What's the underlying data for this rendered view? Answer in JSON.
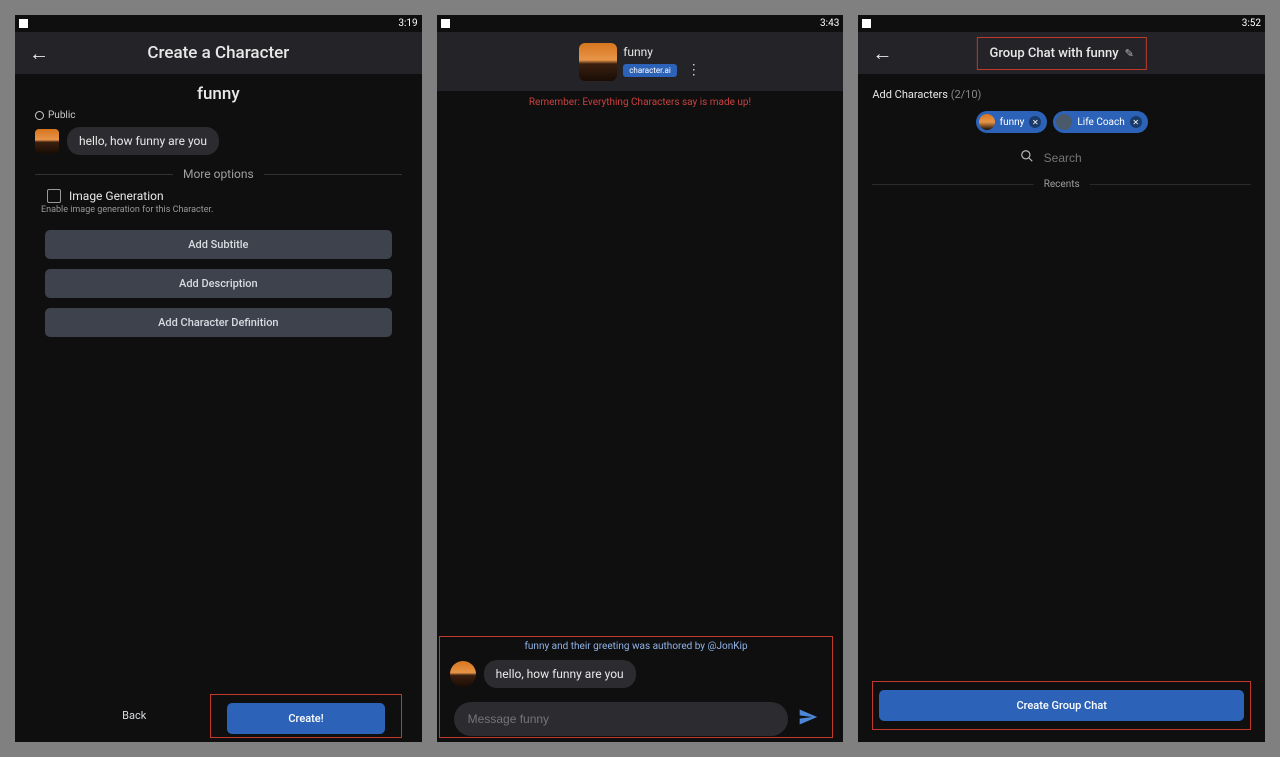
{
  "screen1": {
    "status_time": "3:19",
    "header_title": "Create a Character",
    "character_name": "funny",
    "visibility_label": "Public",
    "greeting": "hello, how funny are you",
    "more_options_label": "More options",
    "image_gen_label": "Image Generation",
    "image_gen_help": "Enable image generation for this Character.",
    "buttons": {
      "add_subtitle": "Add Subtitle",
      "add_description": "Add Description",
      "add_definition": "Add Character Definition"
    },
    "footer_back": "Back",
    "footer_create": "Create!"
  },
  "screen2": {
    "status_time": "3:43",
    "character_name": "funny",
    "badge": "character.ai",
    "warning_text": "Remember: Everything Characters say is made up!",
    "authored_text": "funny and their greeting was authored by @JonKip",
    "greeting": "hello, how funny are you",
    "input_placeholder": "Message funny"
  },
  "screen3": {
    "status_time": "3:52",
    "header_title": "Group Chat with funny",
    "add_chars_label": "Add Characters",
    "add_chars_count": "(2/10)",
    "chips": [
      {
        "name": "funny"
      },
      {
        "name": "Life Coach"
      }
    ],
    "search_placeholder": "Search",
    "recents_label": "Recents",
    "create_button": "Create Group Chat"
  }
}
